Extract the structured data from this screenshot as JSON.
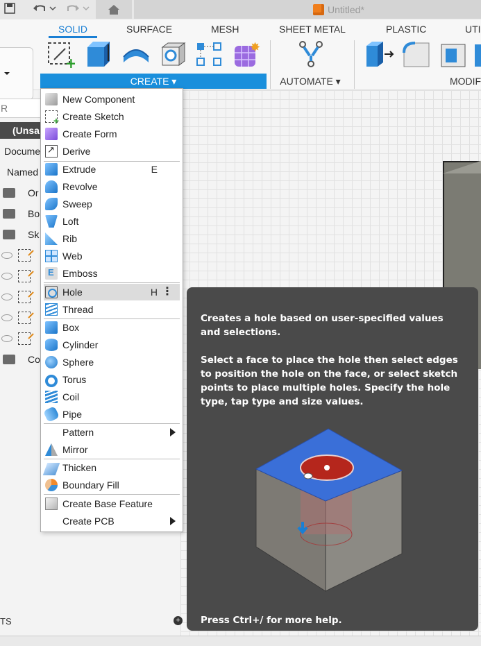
{
  "window": {
    "doc_title": "Untitled*"
  },
  "ribbon": {
    "tabs": [
      "SOLID",
      "SURFACE",
      "MESH",
      "SHEET METAL",
      "PLASTIC",
      "UTI"
    ],
    "active_tab": "SOLID",
    "groups": {
      "create": "CREATE ▾",
      "automate": "AUTOMATE ▾",
      "modify": "MODIF"
    }
  },
  "browser": {
    "search_placeholder": "R",
    "unsaved": "(Unsa",
    "rows": [
      "Docume",
      "Named",
      "Or",
      "Bo",
      "Sk",
      "Co"
    ]
  },
  "menu": {
    "items": [
      {
        "label": "New Component",
        "icon": "new-component-icon"
      },
      {
        "label": "Create Sketch",
        "icon": "create-sketch-icon"
      },
      {
        "label": "Create Form",
        "icon": "create-form-icon"
      },
      {
        "label": "Derive",
        "icon": "derive-icon"
      },
      {
        "label": "Extrude",
        "shortcut": "E",
        "icon": "extrude-icon"
      },
      {
        "label": "Revolve",
        "icon": "revolve-icon"
      },
      {
        "label": "Sweep",
        "icon": "sweep-icon"
      },
      {
        "label": "Loft",
        "icon": "loft-icon"
      },
      {
        "label": "Rib",
        "icon": "rib-icon"
      },
      {
        "label": "Web",
        "icon": "web-icon"
      },
      {
        "label": "Emboss",
        "icon": "emboss-icon"
      },
      {
        "label": "Hole",
        "shortcut": "H",
        "icon": "hole-icon"
      },
      {
        "label": "Thread",
        "icon": "thread-icon"
      },
      {
        "label": "Box",
        "icon": "box-icon"
      },
      {
        "label": "Cylinder",
        "icon": "cylinder-icon"
      },
      {
        "label": "Sphere",
        "icon": "sphere-icon"
      },
      {
        "label": "Torus",
        "icon": "torus-icon"
      },
      {
        "label": "Coil",
        "icon": "coil-icon"
      },
      {
        "label": "Pipe",
        "icon": "pipe-icon"
      },
      {
        "label": "Pattern",
        "icon": "submenu-arrow-icon"
      },
      {
        "label": "Mirror",
        "icon": "mirror-icon"
      },
      {
        "label": "Thicken",
        "icon": "thicken-icon"
      },
      {
        "label": "Boundary Fill",
        "icon": "boundary-fill-icon"
      },
      {
        "label": "Create Base Feature",
        "icon": "base-feature-icon"
      },
      {
        "label": "Create PCB",
        "icon": "submenu-arrow-icon"
      }
    ],
    "highlighted": "Hole"
  },
  "tooltip": {
    "line1": "Creates a hole based on user-specified values and selections.",
    "line2": "Select a face to place the hole then select edges to position the hole on the face, or select sketch points to place multiple holes. Specify the hole type, tap type and size values.",
    "help": "Press Ctrl+/ for more help."
  },
  "bottom": {
    "panel_label": "TS"
  },
  "colors": {
    "accent": "#1a8fdc",
    "tooltip_bg": "#4a4a4a",
    "hole_red": "#c0392b",
    "face_blue": "#3a6fd8"
  }
}
